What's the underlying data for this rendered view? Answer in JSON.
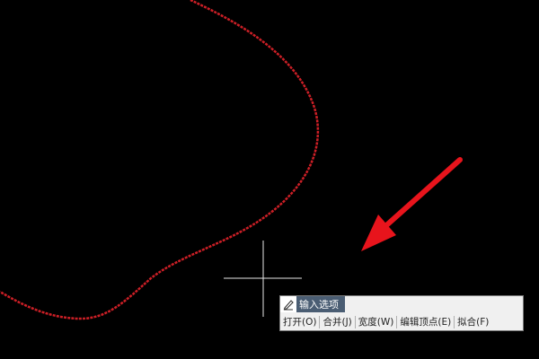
{
  "canvas": {
    "background": "#000000",
    "polyline_color": "#cc1f26",
    "arrow_color": "#e8141c",
    "crosshair_color": "#e8e8e8"
  },
  "input_options": {
    "title": "输入选项",
    "icon": "pen-icon",
    "options": [
      {
        "label": "打开(O)"
      },
      {
        "label": "合并(J)"
      },
      {
        "label": "宽度(W)"
      },
      {
        "label": "编辑顶点(E)"
      },
      {
        "label": "拟合(F)"
      }
    ]
  }
}
